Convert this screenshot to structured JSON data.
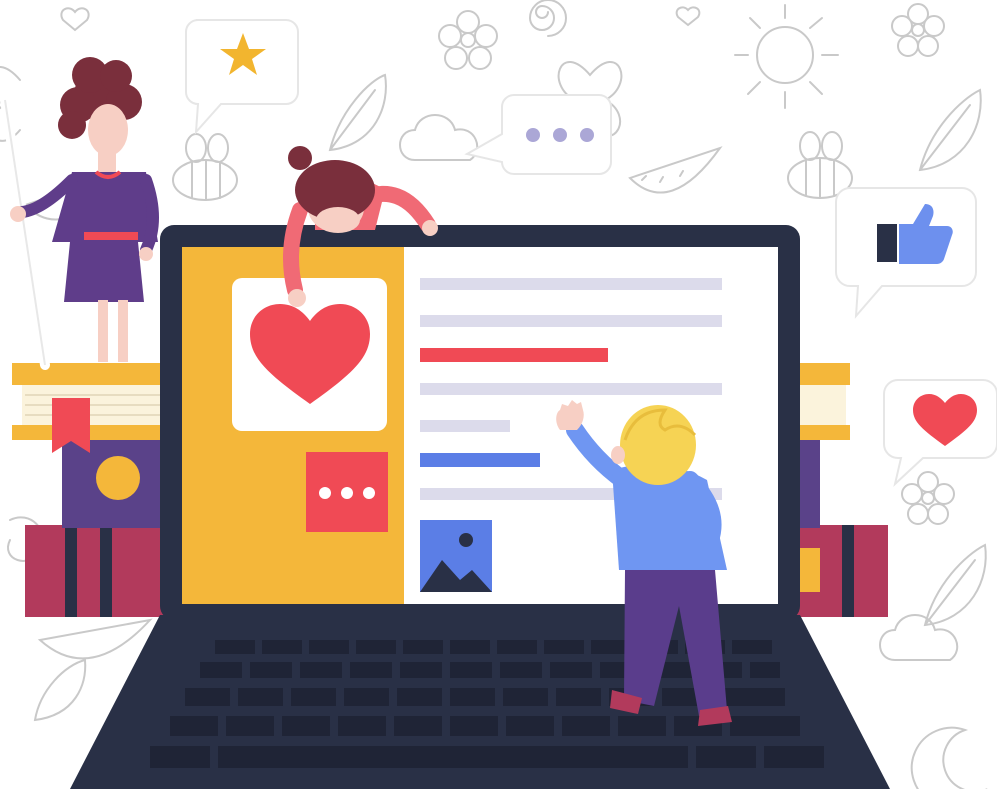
{
  "scene": {
    "background": "#ffffff",
    "doodle_stroke": "#c8c8c8"
  },
  "colors": {
    "laptop_dark": "#293046",
    "laptop_keys": "#1f2436",
    "screen_white": "#ffffff",
    "panel_yellow": "#f4b73a",
    "heart_red": "#f04a55",
    "accent_blue": "#5b7ee6",
    "line_lavender": "#dcdbeb",
    "book_maroon": "#b23a5c",
    "book_purple": "#5a4289",
    "book_cream": "#fbf3dc",
    "skin": "#f7cfc4",
    "hair_brown": "#7a2f3c",
    "hair_blond": "#f6d354",
    "shirt_blue": "#6f96f2",
    "pants_purple": "#5a3d8c",
    "dress_purple": "#5f3d8a",
    "star_yellow": "#f2b52f",
    "thumb_blue": "#6d90ee",
    "dots_lavender": "#aba7d6"
  },
  "bubbles": [
    {
      "id": "star",
      "icon": "star-icon"
    },
    {
      "id": "dots",
      "icon": "ellipsis-icon"
    },
    {
      "id": "like",
      "icon": "thumbs-up-icon"
    },
    {
      "id": "heart",
      "icon": "heart-icon"
    }
  ],
  "screen": {
    "left_panel": {
      "icons": [
        "heart-icon",
        "chat-dots-icon"
      ]
    },
    "text_lines": [
      "lavender",
      "lavender",
      "red",
      "lavender",
      "lavender",
      "blue",
      "lavender"
    ],
    "image_icon": "image-icon"
  },
  "characters": [
    "woman-with-pole",
    "girl-on-laptop-lid",
    "boy-touching-screen"
  ]
}
